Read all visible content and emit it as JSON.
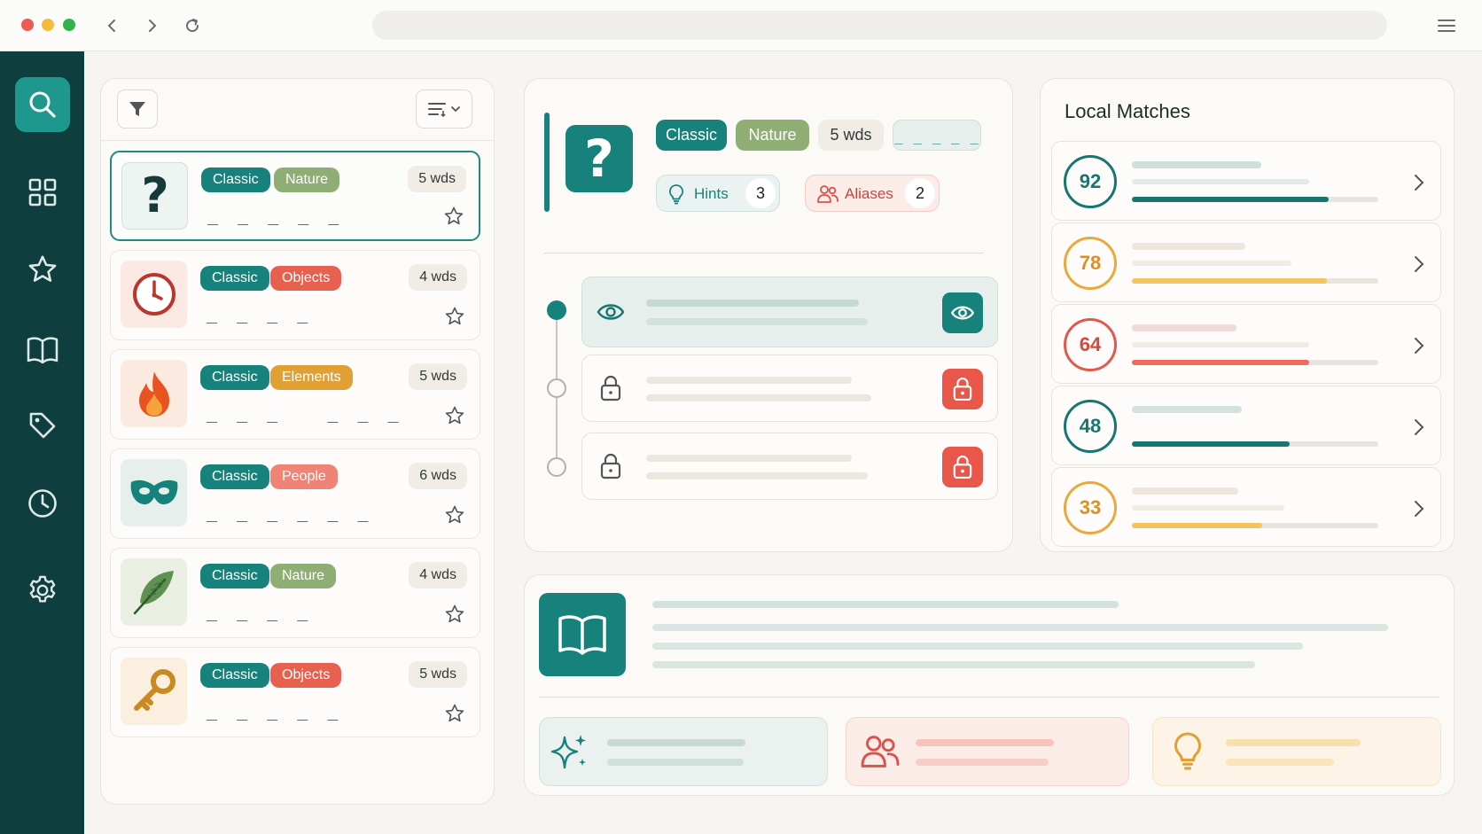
{
  "browser": {
    "buttons": [
      "back",
      "forward",
      "reload",
      "menu"
    ]
  },
  "sidebar": {
    "items": [
      {
        "name": "search",
        "icon": "search-icon",
        "active": true
      },
      {
        "name": "grid",
        "icon": "grid-icon"
      },
      {
        "name": "favorites",
        "icon": "star-icon"
      },
      {
        "name": "library",
        "icon": "book-icon"
      },
      {
        "name": "tags",
        "icon": "tag-icon"
      },
      {
        "name": "history",
        "icon": "clock-icon"
      },
      {
        "name": "settings",
        "icon": "gear-icon"
      }
    ]
  },
  "list": {
    "toolbar": {
      "filter_icon": "filter-icon",
      "sort_icon": "sort-icon"
    },
    "cards": [
      {
        "icon": "question-mark-icon",
        "tags": [
          "Classic",
          "Nature"
        ],
        "words": "5 wds",
        "blanks": "_ _ _ _ _",
        "selected": true
      },
      {
        "icon": "clock-icon",
        "tags": [
          "Classic",
          "Objects"
        ],
        "words": "4 wds",
        "blanks": "_ _ _ _"
      },
      {
        "icon": "fire-icon",
        "tags": [
          "Classic",
          "Elements"
        ],
        "words": "5 wds",
        "blanks": "_ _ _   _ _ _"
      },
      {
        "icon": "mask-icon",
        "tags": [
          "Classic",
          "People"
        ],
        "words": "6 wds",
        "blanks": "_ _ _ _ _ _"
      },
      {
        "icon": "feather-icon",
        "tags": [
          "Classic",
          "Nature"
        ],
        "words": "4 wds",
        "blanks": "_ _ _ _"
      },
      {
        "icon": "key-icon",
        "tags": [
          "Classic",
          "Objects"
        ],
        "words": "5 wds",
        "blanks": "_ _ _ _ _"
      }
    ]
  },
  "detail": {
    "icon": "question-mark-icon",
    "tags": [
      "Classic",
      "Nature"
    ],
    "words": "5 wds",
    "blanks": "_ _ _ _ _",
    "hints_label": "Hints",
    "hints_count": "3",
    "aliases_label": "Aliases",
    "aliases_count": "2",
    "steps": [
      {
        "state": "revealed",
        "icon": "eye-icon"
      },
      {
        "state": "locked",
        "icon": "lock-icon"
      },
      {
        "state": "locked",
        "icon": "lock-icon"
      }
    ]
  },
  "matches": {
    "title": "Local Matches",
    "items": [
      {
        "score": "92",
        "color": "#17766f",
        "fill": 0.8
      },
      {
        "score": "78",
        "color": "#e9a93c",
        "fill": 0.79
      },
      {
        "score": "64",
        "color": "#df5a4c",
        "fill": 0.72
      },
      {
        "score": "48",
        "color": "#17766f",
        "fill": 0.64
      },
      {
        "score": "33",
        "color": "#e9a93c",
        "fill": 0.53
      }
    ]
  },
  "bottom": {
    "icon": "book-open-icon",
    "cards": [
      "sparkle-icon",
      "people-icon",
      "lightbulb-icon"
    ]
  },
  "colors": {
    "teal": "#17827b",
    "sidebar": "#0e3f3e",
    "red": "#e8614f",
    "amber": "#e1a033",
    "sage": "#8fae74"
  }
}
